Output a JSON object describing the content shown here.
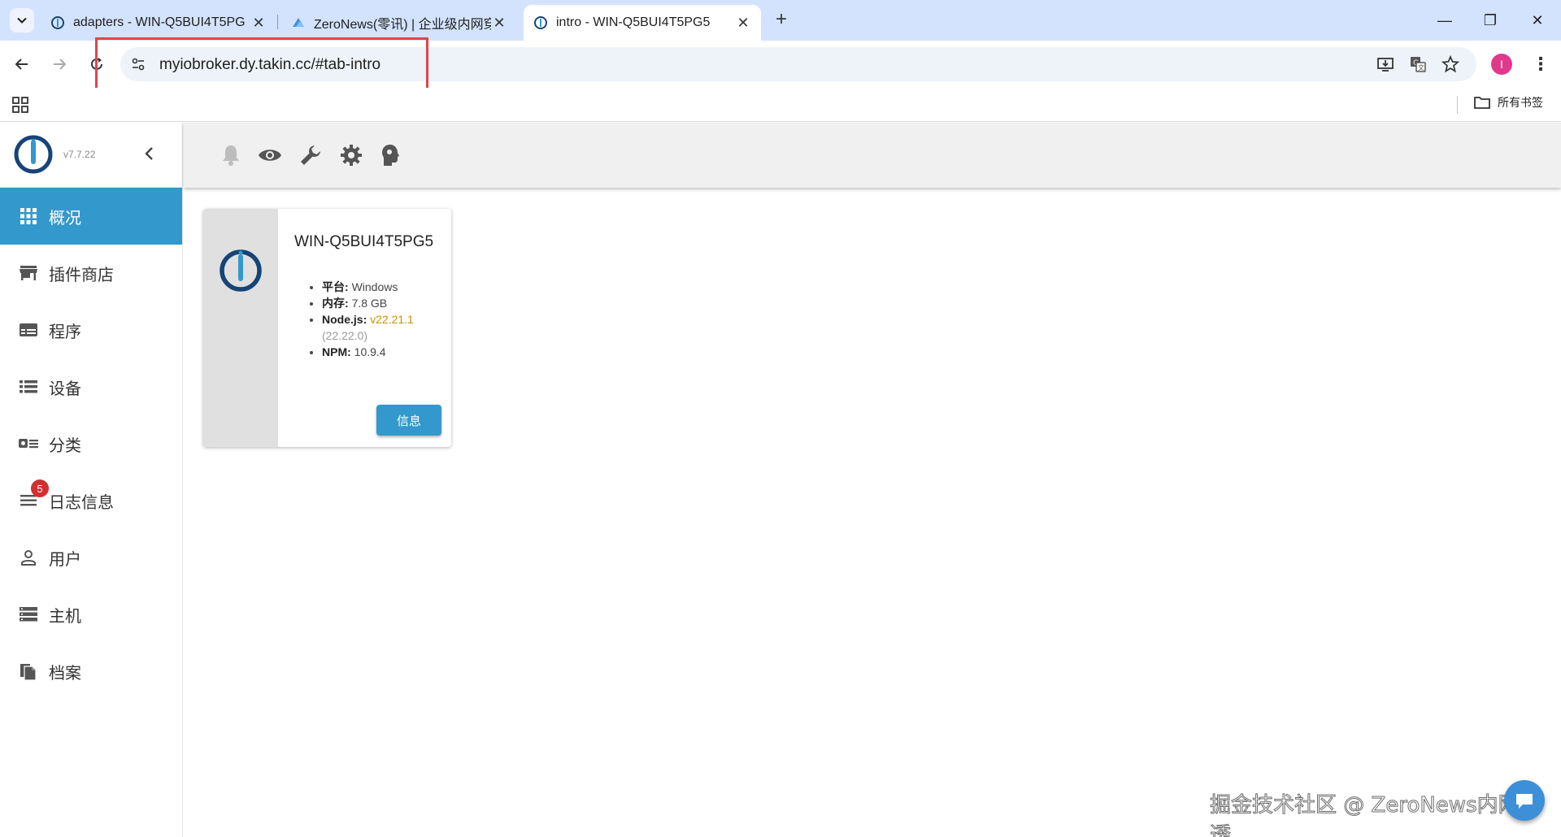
{
  "browser": {
    "tabs": [
      {
        "title": "adapters - WIN-Q5BUI4T5PG",
        "active": false
      },
      {
        "title": "ZeroNews(零讯) | 企业级内网穿",
        "active": false
      },
      {
        "title": "intro - WIN-Q5BUI4T5PG5",
        "active": true
      }
    ],
    "new_tab": "+",
    "window_controls": {
      "minimize": "—",
      "restore": "❐",
      "close": "✕"
    },
    "url": "myiobroker.dy.takin.cc/#tab-intro",
    "profile_initial": "I",
    "bookmarks_all": "所有书签"
  },
  "app": {
    "version": "v7.7.22",
    "menu": [
      {
        "label": "概况",
        "icon": "grid-icon",
        "active": true
      },
      {
        "label": "插件商店",
        "icon": "store-icon",
        "active": false
      },
      {
        "label": "程序",
        "icon": "instances-icon",
        "active": false
      },
      {
        "label": "设备",
        "icon": "list-icon",
        "active": false
      },
      {
        "label": "分类",
        "icon": "categories-icon",
        "active": false
      },
      {
        "label": "日志信息",
        "icon": "log-icon",
        "active": false,
        "badge": "5"
      },
      {
        "label": "用户",
        "icon": "user-icon",
        "active": false
      },
      {
        "label": "主机",
        "icon": "hosts-icon",
        "active": false
      },
      {
        "label": "档案",
        "icon": "files-icon",
        "active": false
      }
    ],
    "toolbar_icons": [
      "bell-icon",
      "eye-icon",
      "wrench-icon",
      "gear-icon",
      "expert-head-icon"
    ]
  },
  "host_card": {
    "title": "WIN-Q5BUI4T5PG5",
    "platform_label": "平台:",
    "platform_value": "Windows",
    "ram_label": "内存:",
    "ram_value": "7.8 GB",
    "node_label": "Node.js:",
    "node_value": "v22.21.1",
    "node_recommended": "(22.22.0)",
    "npm_label": "NPM:",
    "npm_value": "10.9.4",
    "button_label": "信息"
  },
  "watermark": "掘金技术社区 @ ZeroNews内网穿透",
  "colors": {
    "accent": "#3399cc",
    "tabstrip": "#d3e3fd",
    "badge": "#d32f2f",
    "highlight": "#e0444c",
    "node_version": "#c99200"
  }
}
